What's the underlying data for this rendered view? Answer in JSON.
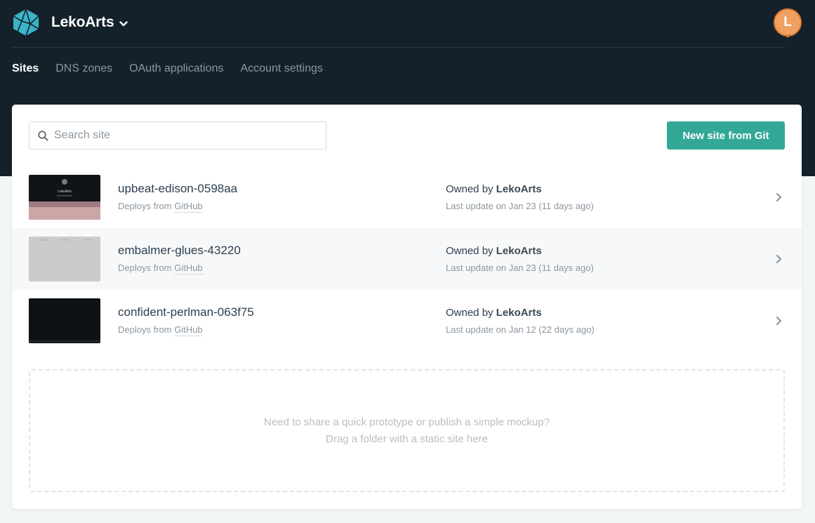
{
  "header": {
    "team_name": "LekoArts",
    "avatar_initial": "L",
    "avatar_color": "#f0a060"
  },
  "nav": {
    "items": [
      {
        "label": "Sites",
        "active": true
      },
      {
        "label": "DNS zones",
        "active": false
      },
      {
        "label": "OAuth applications",
        "active": false
      },
      {
        "label": "Account settings",
        "active": false
      }
    ]
  },
  "search": {
    "placeholder": "Search site",
    "value": ""
  },
  "new_site_button": {
    "label": "New site from Git"
  },
  "sites": [
    {
      "name": "upbeat-edison-0598aa",
      "deploy_prefix": "Deploys from",
      "deploy_source": "GitHub",
      "owner_prefix": "Owned by",
      "owner": "LekoArts",
      "last_update": "Last update on Jan 23 (11 days ago)",
      "thumb_title": "LekoArts"
    },
    {
      "name": "embalmer-glues-43220",
      "deploy_prefix": "Deploys from",
      "deploy_source": "GitHub",
      "owner_prefix": "Owned by",
      "owner": "LekoArts",
      "last_update": "Last update on Jan 23 (11 days ago)"
    },
    {
      "name": "confident-perlman-063f75",
      "deploy_prefix": "Deploys from",
      "deploy_source": "GitHub",
      "owner_prefix": "Owned by",
      "owner": "LekoArts",
      "last_update": "Last update on Jan 12 (22 days ago)"
    }
  ],
  "dropzone": {
    "line1": "Need to share a quick prototype or publish a simple mockup?",
    "line2": "Drag a folder with a static site here"
  },
  "colors": {
    "header_bg": "#14212a",
    "accent": "#33a896",
    "page_bg": "#f2f5f6"
  }
}
